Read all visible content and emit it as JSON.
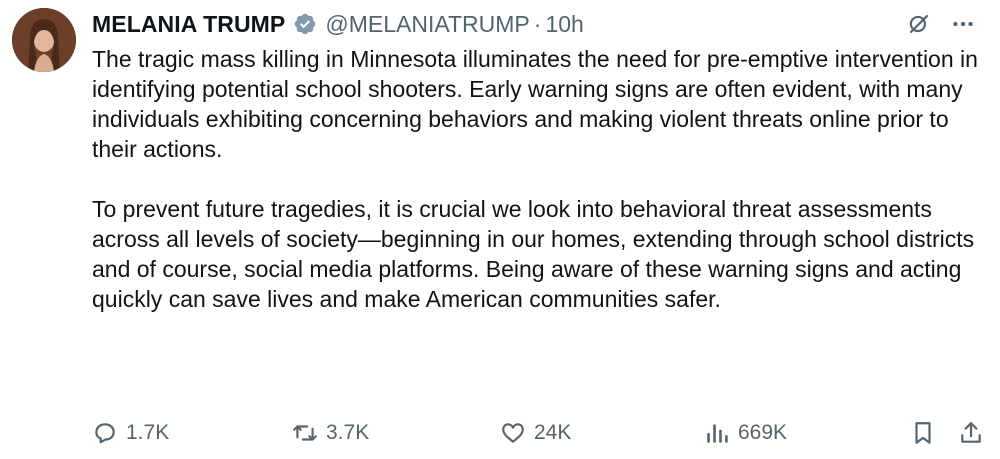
{
  "author": {
    "name": "MELANIA TRUMP",
    "handle": "@MELANIATRUMP",
    "separator": "·",
    "time": "10h",
    "verified_color": "#829aab"
  },
  "header_icons": [
    "grok-icon",
    "more-icon"
  ],
  "tweet": {
    "paragraphs": [
      "The tragic mass killing in Minnesota illuminates the need for pre-emptive intervention in identifying potential school shooters. Early warning signs are often evident, with many individuals exhibiting concerning behaviors and making violent threats online prior to their actions.",
      "To prevent future tragedies, it is crucial we look into behavioral threat assessments across all levels of society—beginning in our homes, extending through school districts and of course, social media platforms. Being aware of these warning signs and acting quickly can save lives and make American communities safer."
    ]
  },
  "metrics": {
    "replies": "1.7K",
    "reposts": "3.7K",
    "likes": "24K",
    "views": "669K"
  },
  "colors": {
    "text": "#0f1419",
    "secondary": "#536471"
  }
}
